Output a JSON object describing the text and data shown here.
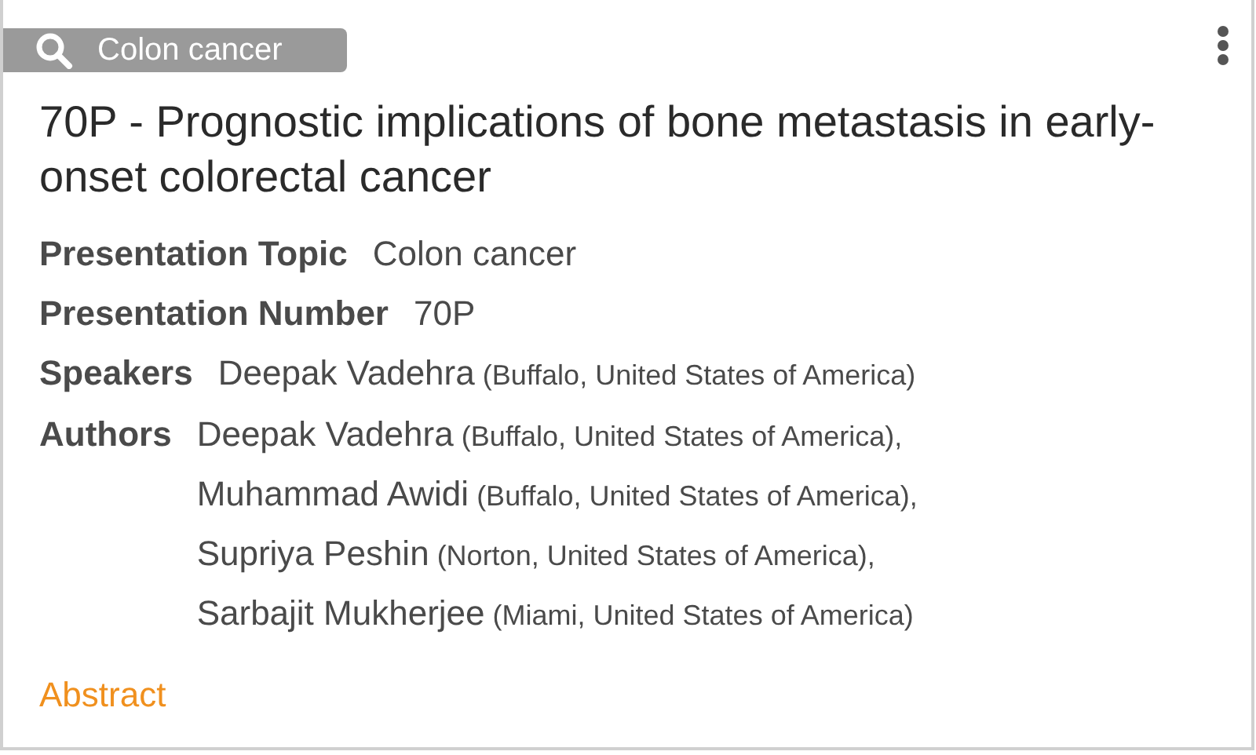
{
  "tag": {
    "label": "Colon cancer"
  },
  "title": "70P - Prognostic implications of bone metastasis in early-onset colorectal cancer",
  "fields": [
    {
      "label": "Presentation Topic",
      "kind": "text",
      "value": "Colon cancer"
    },
    {
      "label": "Presentation Number",
      "kind": "text",
      "value": "70P"
    },
    {
      "label": "Speakers",
      "kind": "people",
      "people": [
        {
          "name": "Deepak Vadehra",
          "affiliation": "(Buffalo, United States of America)"
        }
      ]
    },
    {
      "label": "Authors",
      "kind": "people",
      "people": [
        {
          "name": "Deepak Vadehra",
          "affiliation": "(Buffalo, United States of America),"
        },
        {
          "name": "Muhammad Awidi",
          "affiliation": "(Buffalo, United States of America),"
        },
        {
          "name": "Supriya Peshin",
          "affiliation": "(Norton, United States of America),"
        },
        {
          "name": "Sarbajit Mukherjee",
          "affiliation": "(Miami, United States of America)"
        }
      ]
    }
  ],
  "link": "Abstract"
}
